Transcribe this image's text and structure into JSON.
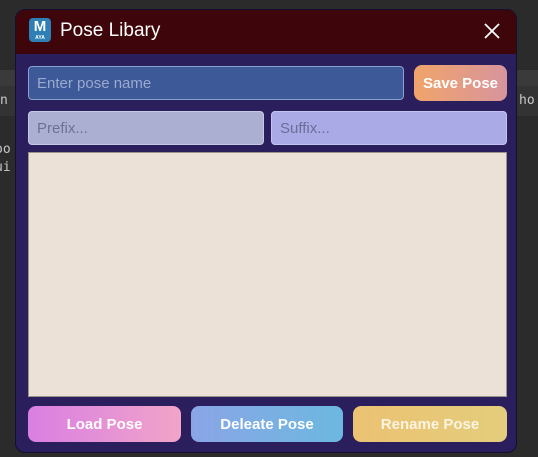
{
  "background": {
    "left_fragment_1": "n",
    "left_fragment_2": "oo",
    "left_fragment_3": "ui",
    "right_fragment": "ho"
  },
  "dialog": {
    "title": "Pose Libary",
    "app_icon": {
      "letter": "M",
      "sub_label": "AYA"
    },
    "close_icon": "close-icon",
    "name_input": {
      "value": "",
      "placeholder": "Enter pose name"
    },
    "save_button": "Save Pose",
    "prefix_input": {
      "value": "",
      "placeholder": "Prefix..."
    },
    "suffix_input": {
      "value": "",
      "placeholder": "Suffix..."
    },
    "pose_list": [],
    "load_button": "Load Pose",
    "delete_button": "Deleate Pose",
    "rename_button": "Rename Pose"
  },
  "colors": {
    "titlebar": "#3e060a",
    "dialog_body": "#2a1e5c",
    "list_background": "#ebe1d7"
  }
}
